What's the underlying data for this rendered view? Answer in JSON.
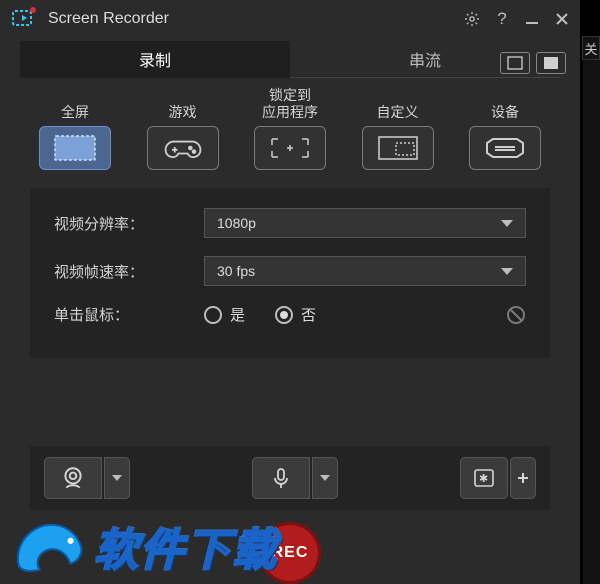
{
  "app": {
    "title": "Screen Recorder"
  },
  "tabs": {
    "record": "录制",
    "stream": "串流"
  },
  "modes": {
    "fullscreen": "全屏",
    "game": "游戏",
    "lockapp": "锁定到\n应用程序",
    "custom": "自定义",
    "device": "设备"
  },
  "settings": {
    "resolution_label": "视频分辨率：",
    "resolution_value": "1080p",
    "framerate_label": "视频帧速率：",
    "framerate_value": "30 fps",
    "mouseclick_label": "单击鼠标：",
    "yes_label": "是",
    "no_label": "否"
  },
  "rec": {
    "label": "REC"
  },
  "side": {
    "label": "关"
  },
  "watermark": {
    "text": "软件下载"
  }
}
